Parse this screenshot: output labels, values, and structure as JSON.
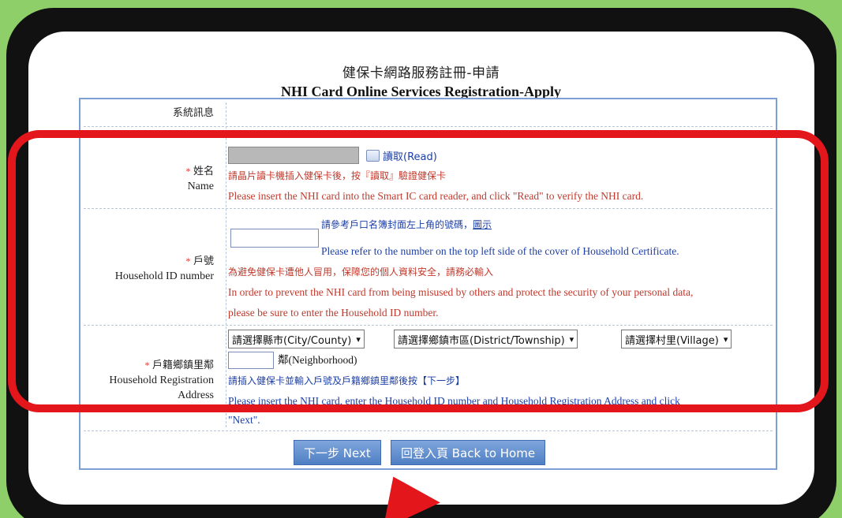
{
  "title_zh": "健保卡網路服務註冊-申請",
  "title_en": "NHI Card Online Services Registration-Apply",
  "system_message_label": "系統訊息",
  "name": {
    "star": "*",
    "label_zh": "姓名",
    "label_en": "Name",
    "read_button": "讀取(Read)",
    "hint_zh": "請晶片讀卡機插入健保卡後，按『讀取』驗證健保卡",
    "hint_en": "Please insert the NHI card into the Smart IC card reader, and click \"Read\" to verify the NHI card."
  },
  "household": {
    "star": "*",
    "label_zh": "戶號",
    "label_en": "Household ID number",
    "hint_zh": "請參考戶口名簿封面左上角的號碼，",
    "hint_link": "圖示",
    "hint_en": "Please refer to the number on the top left side of the cover of Household Certificate.",
    "warn_zh": "為避免健保卡遭他人冒用，保障您的個人資料安全，請務必輸入",
    "warn_en_1": "In order to prevent the NHI card from being misused by others and protect the security of your personal data,",
    "warn_en_2": "please be sure to enter the Household ID number."
  },
  "address": {
    "star": "*",
    "label_zh": "戶籍鄉鎮里鄰",
    "label_en_1": "Household Registration",
    "label_en_2": "Address",
    "select_city": "請選擇縣市(City/County)",
    "select_district": "請選擇鄉鎮市區(District/Township)",
    "select_village": "請選擇村里(Village)",
    "neighborhood": "鄰(Neighborhood)",
    "hint_zh": "請插入健保卡並輸入戶號及戶籍鄉鎮里鄰後按【下一步】",
    "hint_en_1": "Please insert the NHI card, enter the Household ID number and Household Registration Address and click",
    "hint_en_2": "\"Next\"."
  },
  "buttons": {
    "next": "下一步 Next",
    "back": "回登入頁 Back to Home"
  },
  "colors": {
    "highlight": "#e2161b",
    "background": "#8fcf6a",
    "form_border": "#7d9fd4"
  }
}
